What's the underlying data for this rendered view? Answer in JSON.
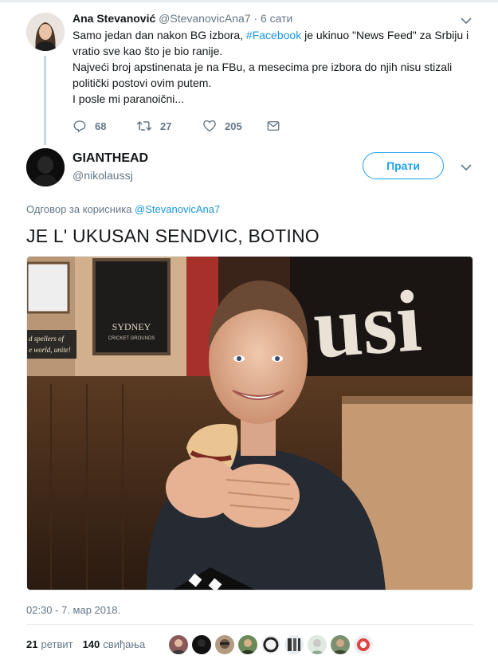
{
  "parent_tweet": {
    "name": "Ana Stevanović",
    "handle": "@StevanovicAna7",
    "time": "· 6 сати",
    "text_line1_pre": "Samo jedan dan nakon BG izbora, ",
    "hashtag": "#Facebook",
    "text_line1_post": " je ukinuo \"News Feed\" za Srbiju i vratio sve kao što je bio ranije.",
    "text_line2": "Najveći broj apstinenata je na FBu, a mesecima pre izbora do njih nisu stizali politički postovi ovim putem.",
    "text_line3": "I posle mi paranoični...",
    "reply_count": "68",
    "retweet_count": "27",
    "like_count": "205"
  },
  "main_tweet": {
    "name": "GIANTHEAD",
    "handle": "@nikolaussj",
    "follow_label": "Прати",
    "reply_prefix": "Одговор за корисника ",
    "reply_to": "@StevanovicAna7",
    "text": "JE L' UKUSAN SENDVIC, BOTINO",
    "timestamp": "02:30 - 7. мар 2018.",
    "retweets_count": "21",
    "retweets_label": "ретвит",
    "likes_count": "140",
    "likes_label": "свиђања",
    "photo_sign_text": "SYDNEY",
    "photo_sign_sub": "CRICKET GROUNDS",
    "photo_chalk_1": "d spellers of",
    "photo_chalk_2": "e world, unite!"
  },
  "colors": {
    "accent": "#1da1f2",
    "link": "#1b95e0",
    "muted": "#657786",
    "border": "#e6ecf0"
  }
}
